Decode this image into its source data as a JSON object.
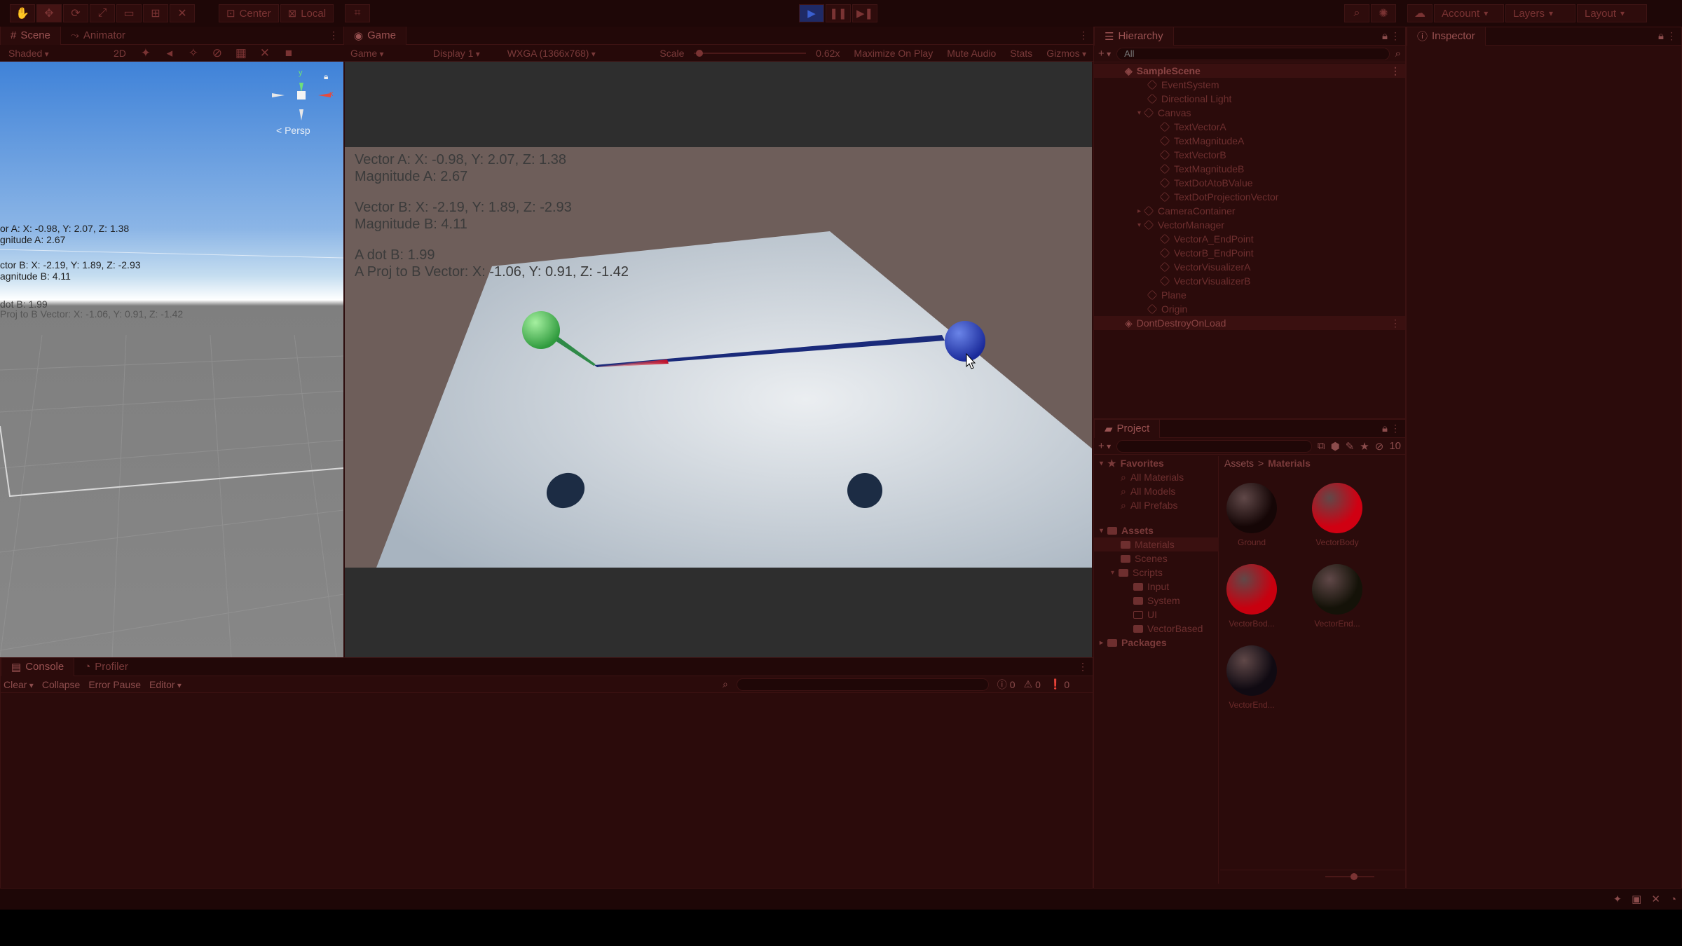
{
  "toolbar": {
    "center_label": "Center",
    "local_label": "Local",
    "account_label": "Account",
    "layers_label": "Layers",
    "layout_label": "Layout"
  },
  "scene_panel": {
    "tabs": [
      {
        "label": "Scene"
      },
      {
        "label": "Animator"
      }
    ],
    "shading_mode": "Shaded",
    "mode_2d": "2D",
    "persp_label": "< Persp",
    "gizmo_axes": {
      "y": "y",
      "x": "x"
    },
    "overlay": {
      "line1": "or A: X: -0.98, Y: 2.07, Z: 1.38",
      "line2": "gnitude A: 2.67",
      "line3": "ctor B: X: -2.19, Y: 1.89, Z: -2.93",
      "line4": "agnitude B: 4.11",
      "line5": "dot B: 1.99",
      "line6": "Proj to B Vector: X: -1.06, Y: 0.91, Z: -1.42"
    }
  },
  "game_panel": {
    "tab_label": "Game",
    "game_dropdown": "Game",
    "display_dropdown": "Display 1",
    "resolution_dropdown": "WXGA (1366x768)",
    "scale_label": "Scale",
    "scale_value": "0.62x",
    "scale_fraction": 0.02,
    "maximize_label": "Maximize On Play",
    "mute_label": "Mute Audio",
    "stats_label": "Stats",
    "gizmos_label": "Gizmos",
    "overlay": {
      "vector_a": "Vector A: X: -0.98, Y: 2.07, Z: 1.38",
      "magnitude_a": "Magnitude A: 2.67",
      "vector_b": "Vector B: X: -2.19, Y: 1.89, Z: -2.93",
      "magnitude_b": "Magnitude B: 4.11",
      "dot": "A dot B: 1.99",
      "proj": "A Proj to B Vector: X: -1.06, Y: 0.91, Z: -1.42"
    }
  },
  "hierarchy": {
    "tab_label": "Hierarchy",
    "search_placeholder": "All",
    "items": [
      {
        "label": "SampleScene"
      },
      {
        "label": "EventSystem"
      },
      {
        "label": "Directional Light"
      },
      {
        "label": "Canvas"
      },
      {
        "label": "TextVectorA"
      },
      {
        "label": "TextMagnitudeA"
      },
      {
        "label": "TextVectorB"
      },
      {
        "label": "TextMagnitudeB"
      },
      {
        "label": "TextDotAtoBValue"
      },
      {
        "label": "TextDotProjectionVector"
      },
      {
        "label": "CameraContainer"
      },
      {
        "label": "VectorManager"
      },
      {
        "label": "VectorA_EndPoint"
      },
      {
        "label": "VectorB_EndPoint"
      },
      {
        "label": "VectorVisualizerA"
      },
      {
        "label": "VectorVisualizerB"
      },
      {
        "label": "Plane"
      },
      {
        "label": "Origin"
      },
      {
        "label": "DontDestroyOnLoad"
      }
    ]
  },
  "inspector": {
    "tab_label": "Inspector"
  },
  "project": {
    "tab_label": "Project",
    "hidden_count": "10",
    "favorites_label": "Favorites",
    "favorites": [
      {
        "label": "All Materials"
      },
      {
        "label": "All Models"
      },
      {
        "label": "All Prefabs"
      }
    ],
    "assets_label": "Assets",
    "folders": [
      {
        "label": "Materials"
      },
      {
        "label": "Scenes"
      },
      {
        "label": "Scripts"
      },
      {
        "label": "Input"
      },
      {
        "label": "System"
      },
      {
        "label": "UI"
      },
      {
        "label": "VectorBased"
      }
    ],
    "packages_label": "Packages",
    "breadcrumb": {
      "root": "Assets",
      "sep": ">",
      "current": "Materials"
    },
    "materials": [
      {
        "label": "Ground",
        "color": "#150606"
      },
      {
        "label": "VectorBody",
        "color": "#d00012"
      },
      {
        "label": "VectorBod...",
        "color": "#c8000f"
      },
      {
        "label": "VectorEnd...",
        "color": "#141208"
      },
      {
        "label": "VectorEnd...",
        "color": "#100a12"
      }
    ]
  },
  "console": {
    "tabs": [
      {
        "label": "Console"
      },
      {
        "label": "Profiler"
      }
    ],
    "clear_label": "Clear",
    "collapse_label": "Collapse",
    "error_pause_label": "Error Pause",
    "editor_label": "Editor",
    "log_count": "0",
    "warn_count": "0",
    "error_count": "0"
  },
  "colors": {
    "vector_a_sphere": "#4fc05a",
    "vector_b_sphere": "#2a3fb0",
    "vector_b_line": "#1a2a7a",
    "projection_line": "#c0102a",
    "ground": "#c4ccd4",
    "background": "#6e5e5a"
  }
}
